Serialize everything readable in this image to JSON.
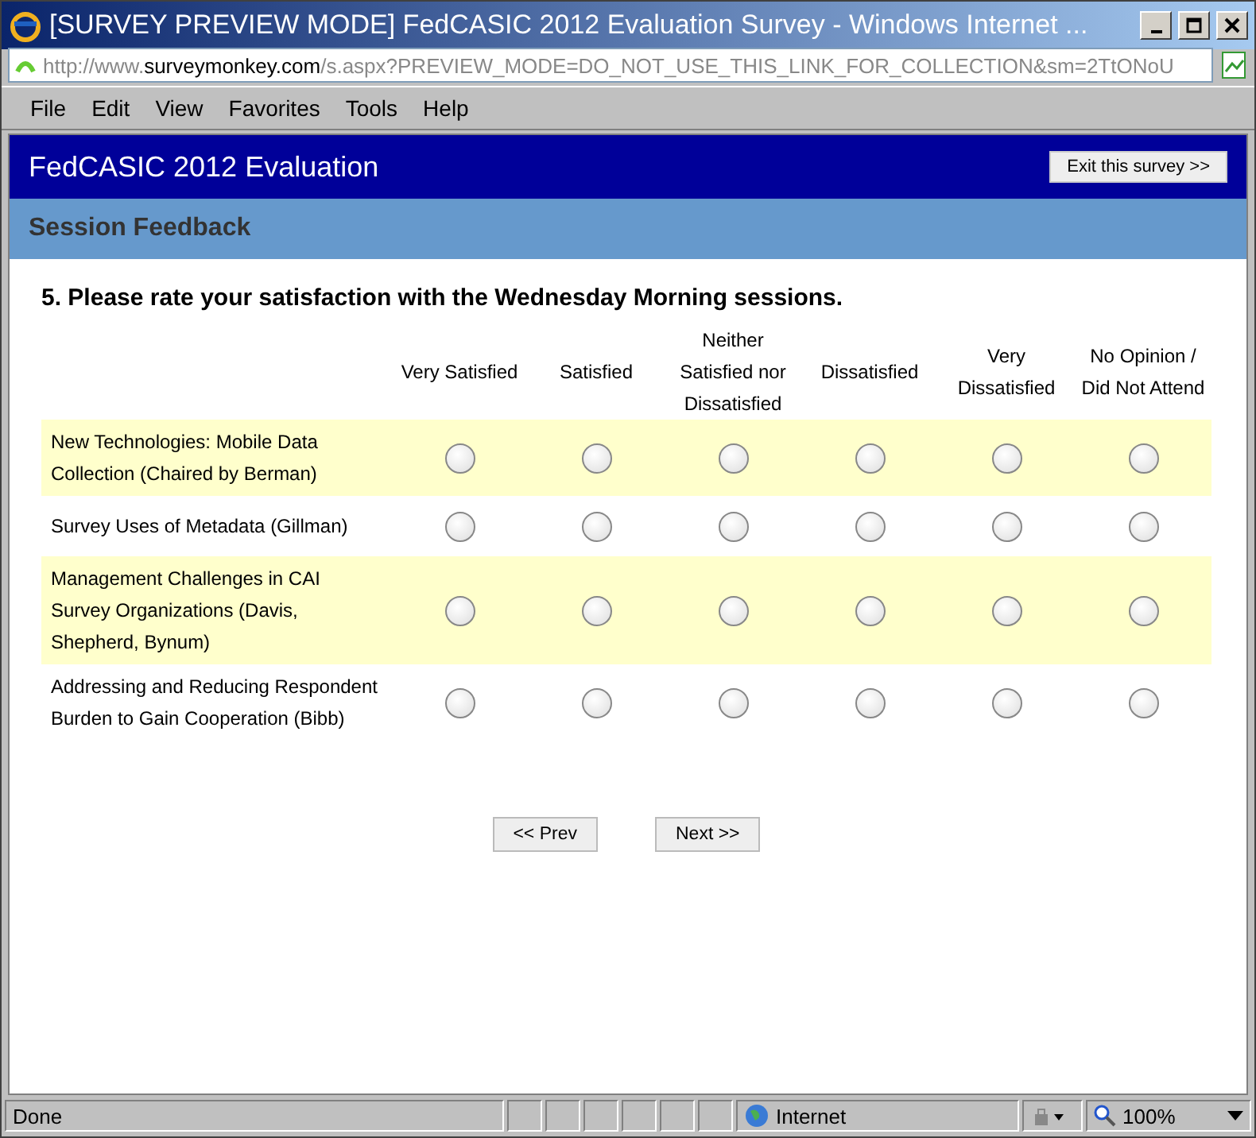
{
  "window": {
    "title": "[SURVEY PREVIEW MODE] FedCASIC 2012 Evaluation Survey - Windows Internet ..."
  },
  "address_bar": {
    "prefix": "http://www.",
    "domain": "surveymonkey.com",
    "rest": "/s.aspx?PREVIEW_MODE=DO_NOT_USE_THIS_LINK_FOR_COLLECTION&sm=2TtONoU"
  },
  "menu": [
    "File",
    "Edit",
    "View",
    "Favorites",
    "Tools",
    "Help"
  ],
  "survey": {
    "title": "FedCASIC 2012 Evaluation",
    "exit_button": "Exit this survey >>",
    "section": "Session Feedback",
    "question": "5. Please rate your satisfaction with the Wednesday Morning sessions.",
    "columns": [
      "Very Satisfied",
      "Satisfied",
      "Neither Satisfied nor Dissatisfied",
      "Dissatisfied",
      "Very Dissatisfied",
      "No Opinion / Did Not Attend"
    ],
    "rows": [
      {
        "label": "New Technologies: Mobile Data Collection (Chaired by Berman)",
        "choices": [
          {
            "selected": false
          },
          {
            "selected": false
          },
          {
            "selected": false
          },
          {
            "selected": false
          },
          {
            "selected": false
          },
          {
            "selected": false
          }
        ]
      },
      {
        "label": "Survey Uses of Metadata (Gillman)",
        "choices": [
          {
            "selected": false
          },
          {
            "selected": false
          },
          {
            "selected": false
          },
          {
            "selected": false
          },
          {
            "selected": false
          },
          {
            "selected": false
          }
        ]
      },
      {
        "label": "Management Challenges in CAI Survey Organizations (Davis, Shepherd, Bynum)",
        "choices": [
          {
            "selected": false
          },
          {
            "selected": false
          },
          {
            "selected": false
          },
          {
            "selected": false
          },
          {
            "selected": false
          },
          {
            "selected": false
          }
        ]
      },
      {
        "label": "Addressing and Reducing Respondent Burden to Gain Cooperation (Bibb)",
        "choices": [
          {
            "selected": false
          },
          {
            "selected": false
          },
          {
            "selected": false
          },
          {
            "selected": false
          },
          {
            "selected": false
          },
          {
            "selected": false
          }
        ]
      }
    ],
    "prev_button": "<< Prev",
    "next_button": "Next >>"
  },
  "status_bar": {
    "text": "Done",
    "zone": "Internet",
    "zoom": "100%"
  }
}
